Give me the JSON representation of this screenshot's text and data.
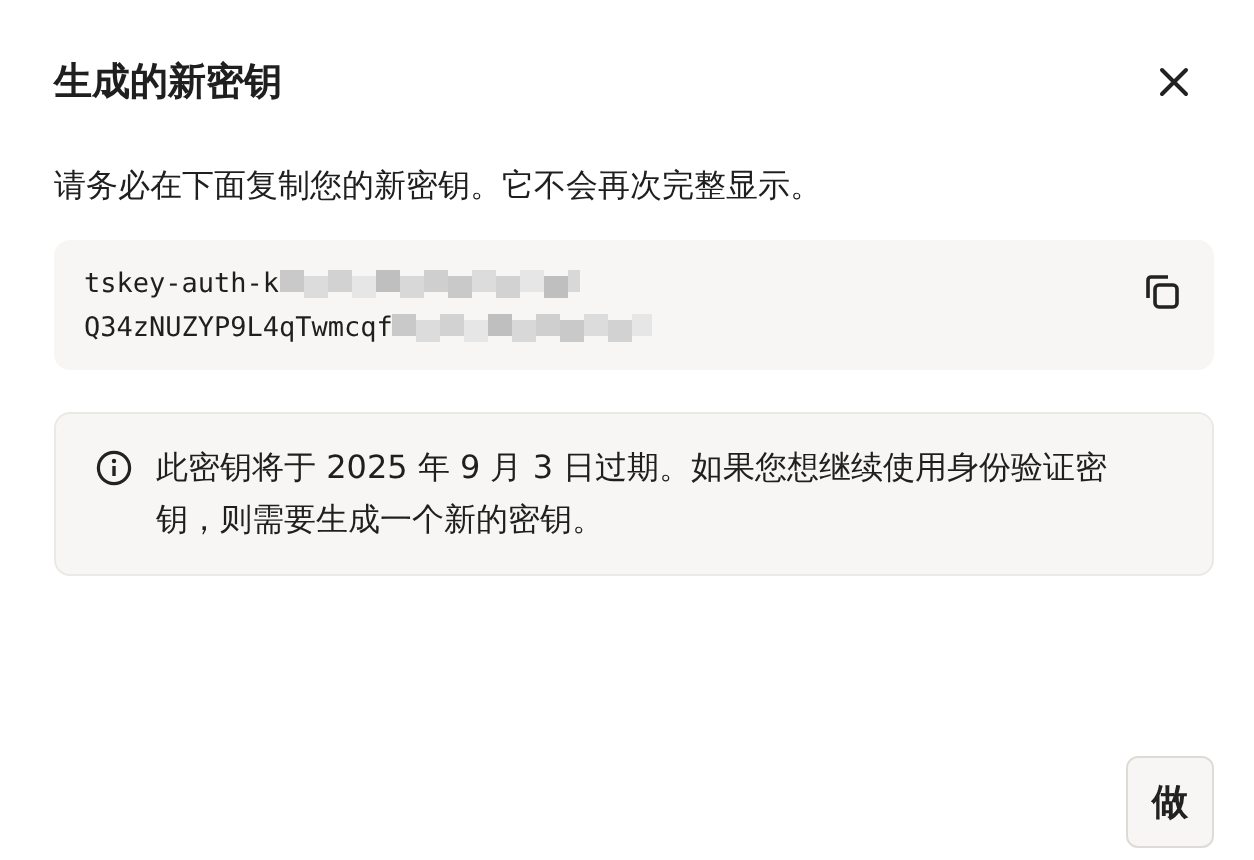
{
  "dialog": {
    "title": "生成的新密钥",
    "message": "请务必在下面复制您的新密钥。它不会再次完整显示。",
    "key_lines": [
      "tskey-auth-k",
      "Q34zNUZYP9L4qTwmcqf"
    ],
    "notice": "此密钥将于 2025 年 9 月 3 日过期。如果您想继续使用身份验证密钥，则需要生成一个新的密钥。",
    "buttons": [
      "做"
    ]
  }
}
